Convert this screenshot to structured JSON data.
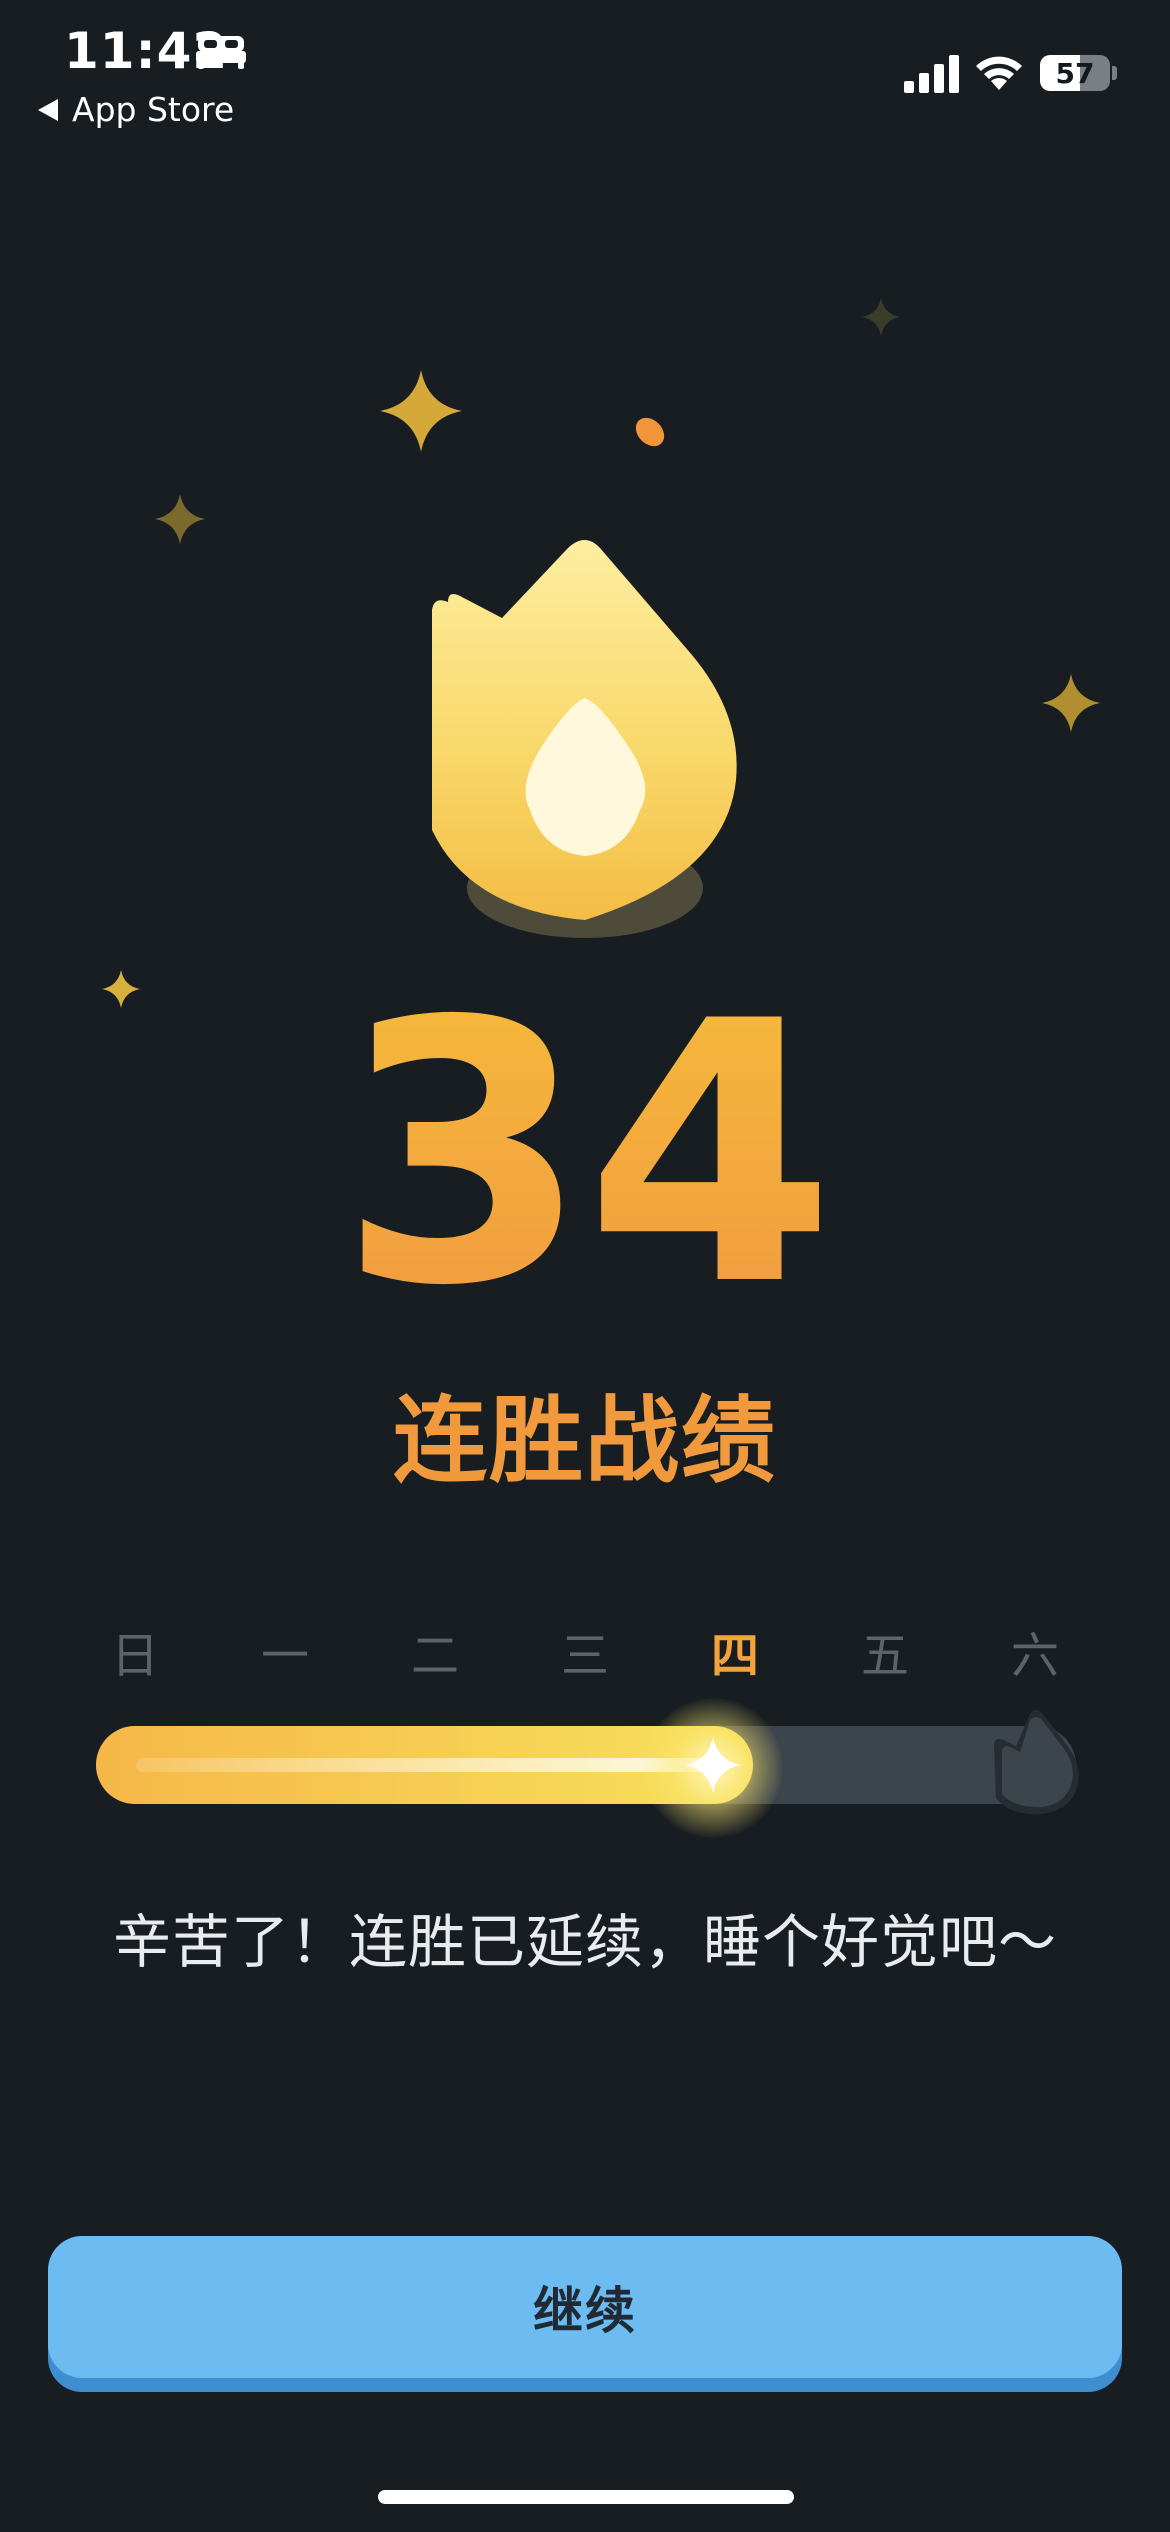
{
  "status_bar": {
    "time": "11:42",
    "back_label": "App Store",
    "battery": "57",
    "icons": [
      "bed-icon",
      "signal-icon",
      "wifi-icon",
      "battery-icon"
    ]
  },
  "streak": {
    "count": "34",
    "title": "连胜战绩"
  },
  "week": {
    "days": [
      "日",
      "一",
      "二",
      "三",
      "四",
      "五",
      "六"
    ],
    "current_day_index": 4,
    "progress_fraction": 0.67
  },
  "message": "辛苦了！连胜已延续，睡个好觉吧～",
  "continue_button": {
    "label": "继续"
  },
  "colors": {
    "background": "#181d22",
    "accent_orange": "#f2a33e",
    "progress_yellow": "#f8e15c",
    "button_blue": "#6dbcf1"
  }
}
